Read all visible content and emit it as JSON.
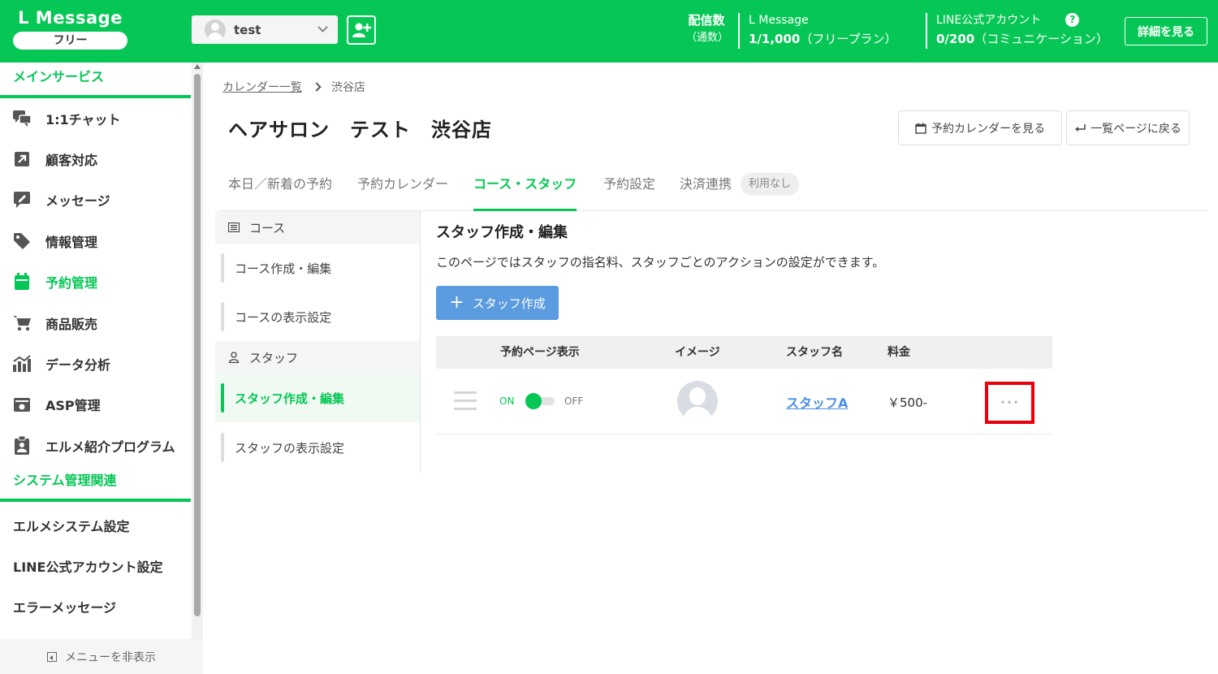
{
  "header": {
    "logo_title": "L Message",
    "plan_badge": "フリー",
    "account_name": "test",
    "delivery_label": "配信数",
    "delivery_sub": "（通数）",
    "lmessage_label": "L Message",
    "lmessage_count": "1/1,000",
    "lmessage_plan": "（フリープラン）",
    "line_label": "LINE公式アカウント",
    "line_count": "0/200",
    "line_plan": "（コミュニケーション）",
    "help_icon_glyph": "?",
    "details_button": "詳細を見る",
    "brand_color": "#06c755"
  },
  "sidebar": {
    "section_main": "メインサービス",
    "items": [
      {
        "label": "1:1チャット",
        "icon": "chat-icon"
      },
      {
        "label": "顧客対応",
        "icon": "external-link-icon"
      },
      {
        "label": "メッセージ",
        "icon": "message-edit-icon"
      },
      {
        "label": "情報管理",
        "icon": "tag-icon"
      },
      {
        "label": "予約管理",
        "icon": "calendar-icon",
        "active": true
      },
      {
        "label": "商品販売",
        "icon": "cart-icon"
      },
      {
        "label": "データ分析",
        "icon": "chart-icon"
      },
      {
        "label": "ASP管理",
        "icon": "asp-icon"
      },
      {
        "label": "エルメ紹介プログラム",
        "icon": "clipboard-user-icon"
      }
    ],
    "section_system": "システム管理関連",
    "system_items": [
      {
        "label": "エルメシステム設定"
      },
      {
        "label": "LINE公式アカウント設定"
      },
      {
        "label": "エラーメッセージ"
      }
    ],
    "hide_menu": "メニューを非表示"
  },
  "breadcrumb": {
    "parent": "カレンダー一覧",
    "current": "渋谷店"
  },
  "page": {
    "title": "ヘアサロン　テスト　渋谷店",
    "view_calendar_button": "予約カレンダーを見る",
    "back_button": "一覧ページに戻る"
  },
  "tabs": [
    {
      "label": "本日／新着の予約"
    },
    {
      "label": "予約カレンダー"
    },
    {
      "label": "コース・スタッフ",
      "active": true
    },
    {
      "label": "予約設定"
    },
    {
      "label": "決済連携"
    }
  ],
  "tab_badge": "利用なし",
  "subnav": {
    "course_head": "コース",
    "course_items": [
      "コース作成・編集",
      "コースの表示設定"
    ],
    "staff_head": "スタッフ",
    "staff_items": [
      "スタッフ作成・編集",
      "スタッフの表示設定"
    ]
  },
  "content": {
    "title": "スタッフ作成・編集",
    "description": "このページではスタッフの指名料、スタッフごとのアクションの設定ができます。",
    "create_button": "スタッフ作成"
  },
  "table": {
    "columns": [
      "予約ページ表示",
      "イメージ",
      "スタッフ名",
      "料金"
    ],
    "rows": [
      {
        "on_label": "ON",
        "off_label": "OFF",
        "enabled": true,
        "name": "スタッフA",
        "price": "￥500-",
        "more": "•••"
      }
    ]
  }
}
